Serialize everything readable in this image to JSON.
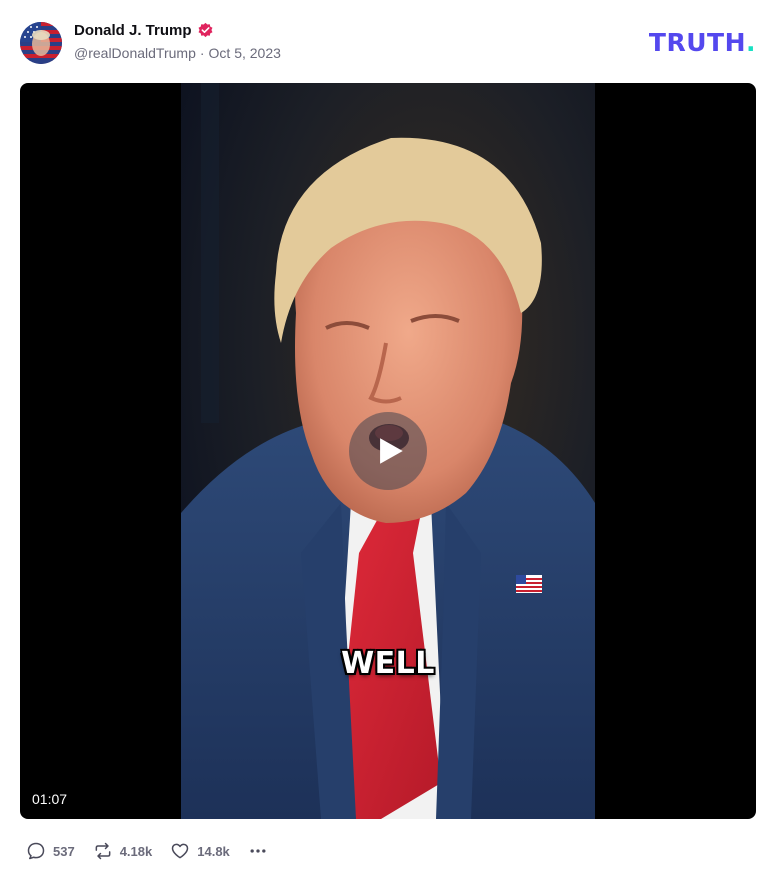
{
  "post": {
    "author": {
      "display_name": "Donald J. Trump",
      "handle": "@realDonaldTrump",
      "separator": "·",
      "date": "Oct 5, 2023",
      "verified_icon": "verified-badge-icon",
      "verified_color": "#e0245e"
    },
    "brand": {
      "logo_text": "TRUTH",
      "logo_dot": ".",
      "logo_color": "#5448ee",
      "dot_color": "#17e1c3"
    },
    "video": {
      "caption": "WELL",
      "duration": "01:07",
      "play_icon": "play-icon"
    },
    "actions": {
      "replies": "537",
      "reposts": "4.18k",
      "likes": "14.8k",
      "reply_icon": "comment-icon",
      "repost_icon": "repost-icon",
      "like_icon": "heart-icon",
      "more_icon": "more-dots-icon"
    }
  }
}
